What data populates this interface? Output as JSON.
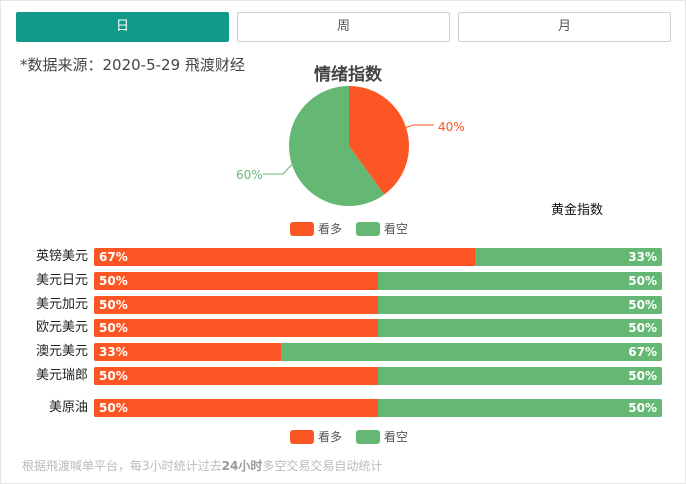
{
  "tabs": [
    {
      "label": "日",
      "active": true
    },
    {
      "label": "周",
      "active": false
    },
    {
      "label": "月",
      "active": false
    }
  ],
  "source": "*数据来源：2020-5-29 飛渡财经",
  "title": "情绪指数",
  "colors": {
    "bull": "#fc5624",
    "bear": "#65b873",
    "accent": "#11998a"
  },
  "pie": {
    "bull_pct": 40,
    "bear_pct": 60,
    "bull_label": "40%",
    "bear_label": "60%"
  },
  "legend": {
    "bull": "看多",
    "bear": "看空"
  },
  "gold_label": "黄金指数",
  "rows": [
    {
      "name": "英镑美元",
      "bull": 67,
      "bear": 33,
      "bull_label": "67%",
      "bear_label": "33%"
    },
    {
      "name": "美元日元",
      "bull": 50,
      "bear": 50,
      "bull_label": "50%",
      "bear_label": "50%"
    },
    {
      "name": "美元加元",
      "bull": 50,
      "bear": 50,
      "bull_label": "50%",
      "bear_label": "50%"
    },
    {
      "name": "欧元美元",
      "bull": 50,
      "bear": 50,
      "bull_label": "50%",
      "bear_label": "50%"
    },
    {
      "name": "澳元美元",
      "bull": 33,
      "bear": 67,
      "bull_label": "33%",
      "bear_label": "67%"
    },
    {
      "name": "美元瑞郎",
      "bull": 50,
      "bear": 50,
      "bull_label": "50%",
      "bear_label": "50%"
    },
    {
      "name": "美原油",
      "bull": 50,
      "bear": 50,
      "bull_label": "50%",
      "bear_label": "50%"
    }
  ],
  "footnote": {
    "pre": "根据飛渡喊单平台，每3小时统计过去",
    "bold": "24小时",
    "post": "多空交易交易自动统计"
  }
}
